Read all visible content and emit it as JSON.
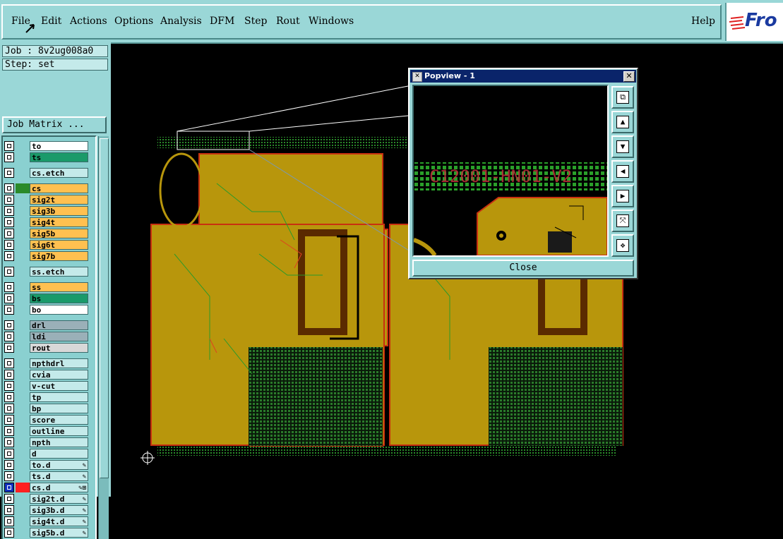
{
  "menu": {
    "items": [
      "File",
      "Edit",
      "Actions",
      "Options",
      "Analysis",
      "DFM",
      "Step",
      "Rout",
      "Windows"
    ],
    "help": "Help",
    "logo_text": "Fro"
  },
  "left_panel": {
    "job_label": "Job : 8v2ug008a0",
    "step_label": "Step: set",
    "job_matrix_button": "Job Matrix ..."
  },
  "layers": [
    {
      "name": "to",
      "color": "#ffffff",
      "swatch": ""
    },
    {
      "name": "ts",
      "color": "#1a9a6a",
      "swatch": ""
    },
    {
      "name": "cs.etch",
      "color": "#c4eaea",
      "swatch": ""
    },
    {
      "name": "cs",
      "color": "#ffc050",
      "swatch": "#2a8a2a"
    },
    {
      "name": "sig2t",
      "color": "#ffc050",
      "swatch": ""
    },
    {
      "name": "sig3b",
      "color": "#ffc050",
      "swatch": ""
    },
    {
      "name": "sig4t",
      "color": "#ffc050",
      "swatch": ""
    },
    {
      "name": "sig5b",
      "color": "#ffc050",
      "swatch": ""
    },
    {
      "name": "sig6t",
      "color": "#ffc050",
      "swatch": ""
    },
    {
      "name": "sig7b",
      "color": "#ffc050",
      "swatch": ""
    },
    {
      "name": "ss.etch",
      "color": "#c4eaea",
      "swatch": ""
    },
    {
      "name": "ss",
      "color": "#ffc050",
      "swatch": ""
    },
    {
      "name": "bs",
      "color": "#1a9a6a",
      "swatch": ""
    },
    {
      "name": "bo",
      "color": "#ffffff",
      "swatch": ""
    },
    {
      "name": "drl",
      "color": "#9ab0b8",
      "swatch": ""
    },
    {
      "name": "ldi",
      "color": "#9ab0b8",
      "swatch": ""
    },
    {
      "name": "rout",
      "color": "#d8d8d8",
      "swatch": ""
    },
    {
      "name": "npthdrl",
      "color": "#c4eaea",
      "swatch": ""
    },
    {
      "name": "cvia",
      "color": "#c4eaea",
      "swatch": ""
    },
    {
      "name": "v-cut",
      "color": "#c4eaea",
      "swatch": ""
    },
    {
      "name": "tp",
      "color": "#c4eaea",
      "swatch": ""
    },
    {
      "name": "bp",
      "color": "#c4eaea",
      "swatch": ""
    },
    {
      "name": "score",
      "color": "#c4eaea",
      "swatch": ""
    },
    {
      "name": "outline",
      "color": "#c4eaea",
      "swatch": ""
    },
    {
      "name": "npth",
      "color": "#c4eaea",
      "swatch": ""
    },
    {
      "name": "d",
      "color": "#c4eaea",
      "swatch": ""
    },
    {
      "name": "to.d",
      "color": "#c4eaea",
      "swatch": "",
      "mark": "✎"
    },
    {
      "name": "ts.d",
      "color": "#c4eaea",
      "swatch": "",
      "mark": "✎"
    },
    {
      "name": "cs.d",
      "color": "#c4eaea",
      "swatch": "#ff2020",
      "mark": "✎⊞",
      "active": true
    },
    {
      "name": "sig2t.d",
      "color": "#c4eaea",
      "swatch": "",
      "mark": "✎"
    },
    {
      "name": "sig3b.d",
      "color": "#c4eaea",
      "swatch": "",
      "mark": "✎"
    },
    {
      "name": "sig4t.d",
      "color": "#c4eaea",
      "swatch": "",
      "mark": "✎"
    },
    {
      "name": "sig5b.d",
      "color": "#c4eaea",
      "swatch": "",
      "mark": "✎"
    }
  ],
  "popview": {
    "title": "Popview - 1",
    "close_button": "Close",
    "zoom_text": "C12001-HN01-V2",
    "tools": [
      "zoom-fit-icon",
      "pan-up-icon",
      "pan-down-icon",
      "pan-left-icon",
      "pan-right-icon",
      "zoom-out-icon",
      "zoom-in-icon"
    ]
  },
  "colors": {
    "panel_bg": "#9ad7d7",
    "copper": "#b8960c",
    "board_outline": "#c83010",
    "trace_green": "#2a9a2a"
  }
}
